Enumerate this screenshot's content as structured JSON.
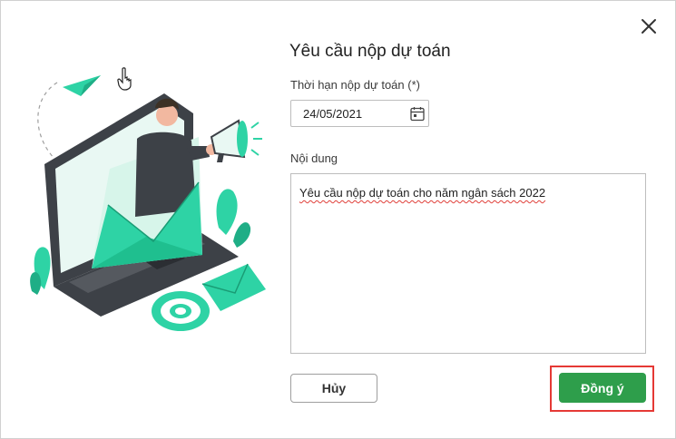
{
  "dialog": {
    "title": "Yêu cầu nộp dự toán",
    "deadline_label": "Thời hạn nộp dự toán (*)",
    "deadline_value": "24/05/2021",
    "content_label": "Nội dung",
    "content_value": "Yêu cầu nộp dự toán cho năm ngân sách 2022",
    "cancel_label": "Hủy",
    "ok_label": "Đồng ý"
  },
  "icons": {
    "close": "close-icon",
    "calendar": "calendar-icon",
    "cursor": "hand-cursor-icon"
  },
  "colors": {
    "accent_green": "#2e9e4b",
    "illustration_teal": "#2ed3a5",
    "highlight_red": "#e53935"
  }
}
